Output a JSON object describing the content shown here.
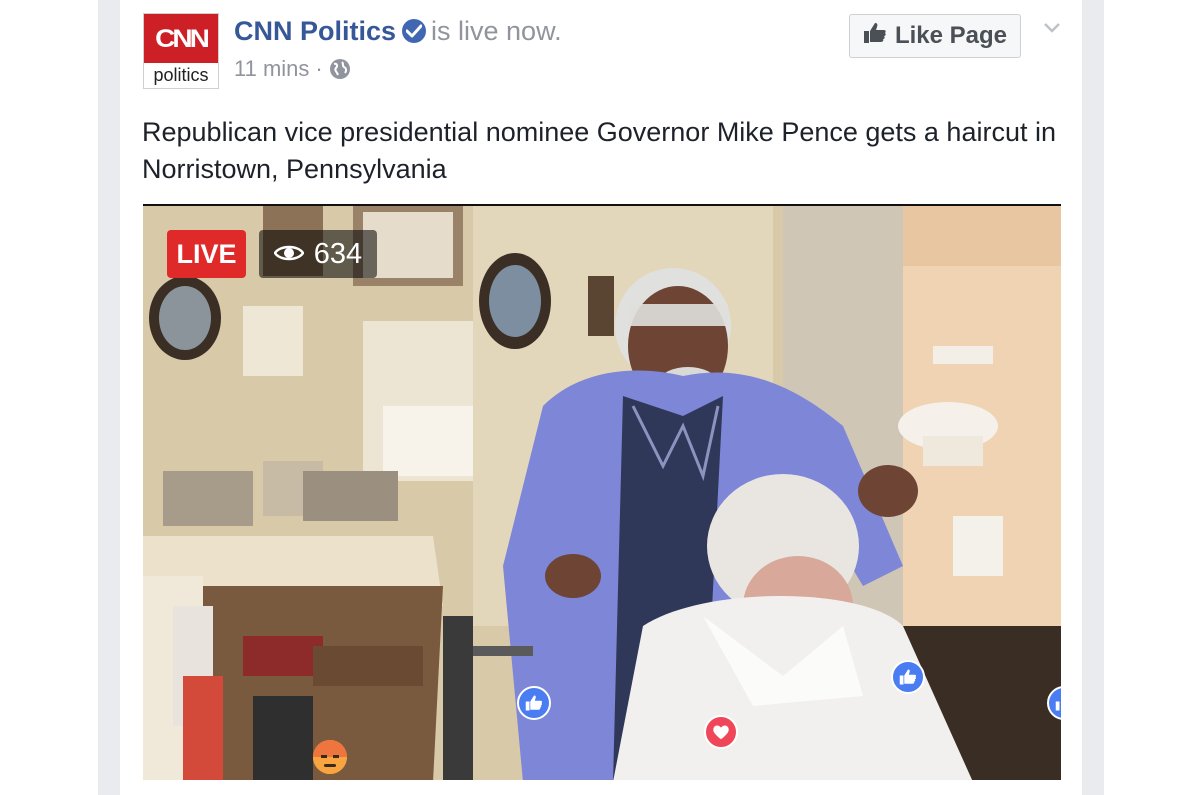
{
  "post": {
    "page_name": "CNN Politics",
    "status": "is live now.",
    "time": "11 mins",
    "separator": "·",
    "text": "Republican vice presidential nominee Governor Mike Pence gets a haircut in Norristown, Pennsylvania",
    "avatar": {
      "brand": "CNN",
      "label": "politics"
    },
    "like_button_label": "Like Page"
  },
  "video": {
    "live_label": "LIVE",
    "viewer_count": "634",
    "reactions": [
      "like-icon",
      "love-icon",
      "angry-icon",
      "like-icon",
      "like-icon"
    ]
  },
  "colors": {
    "link": "#365899",
    "meta": "#90949c",
    "live": "#e02a2a",
    "verified": "#4267b2"
  }
}
